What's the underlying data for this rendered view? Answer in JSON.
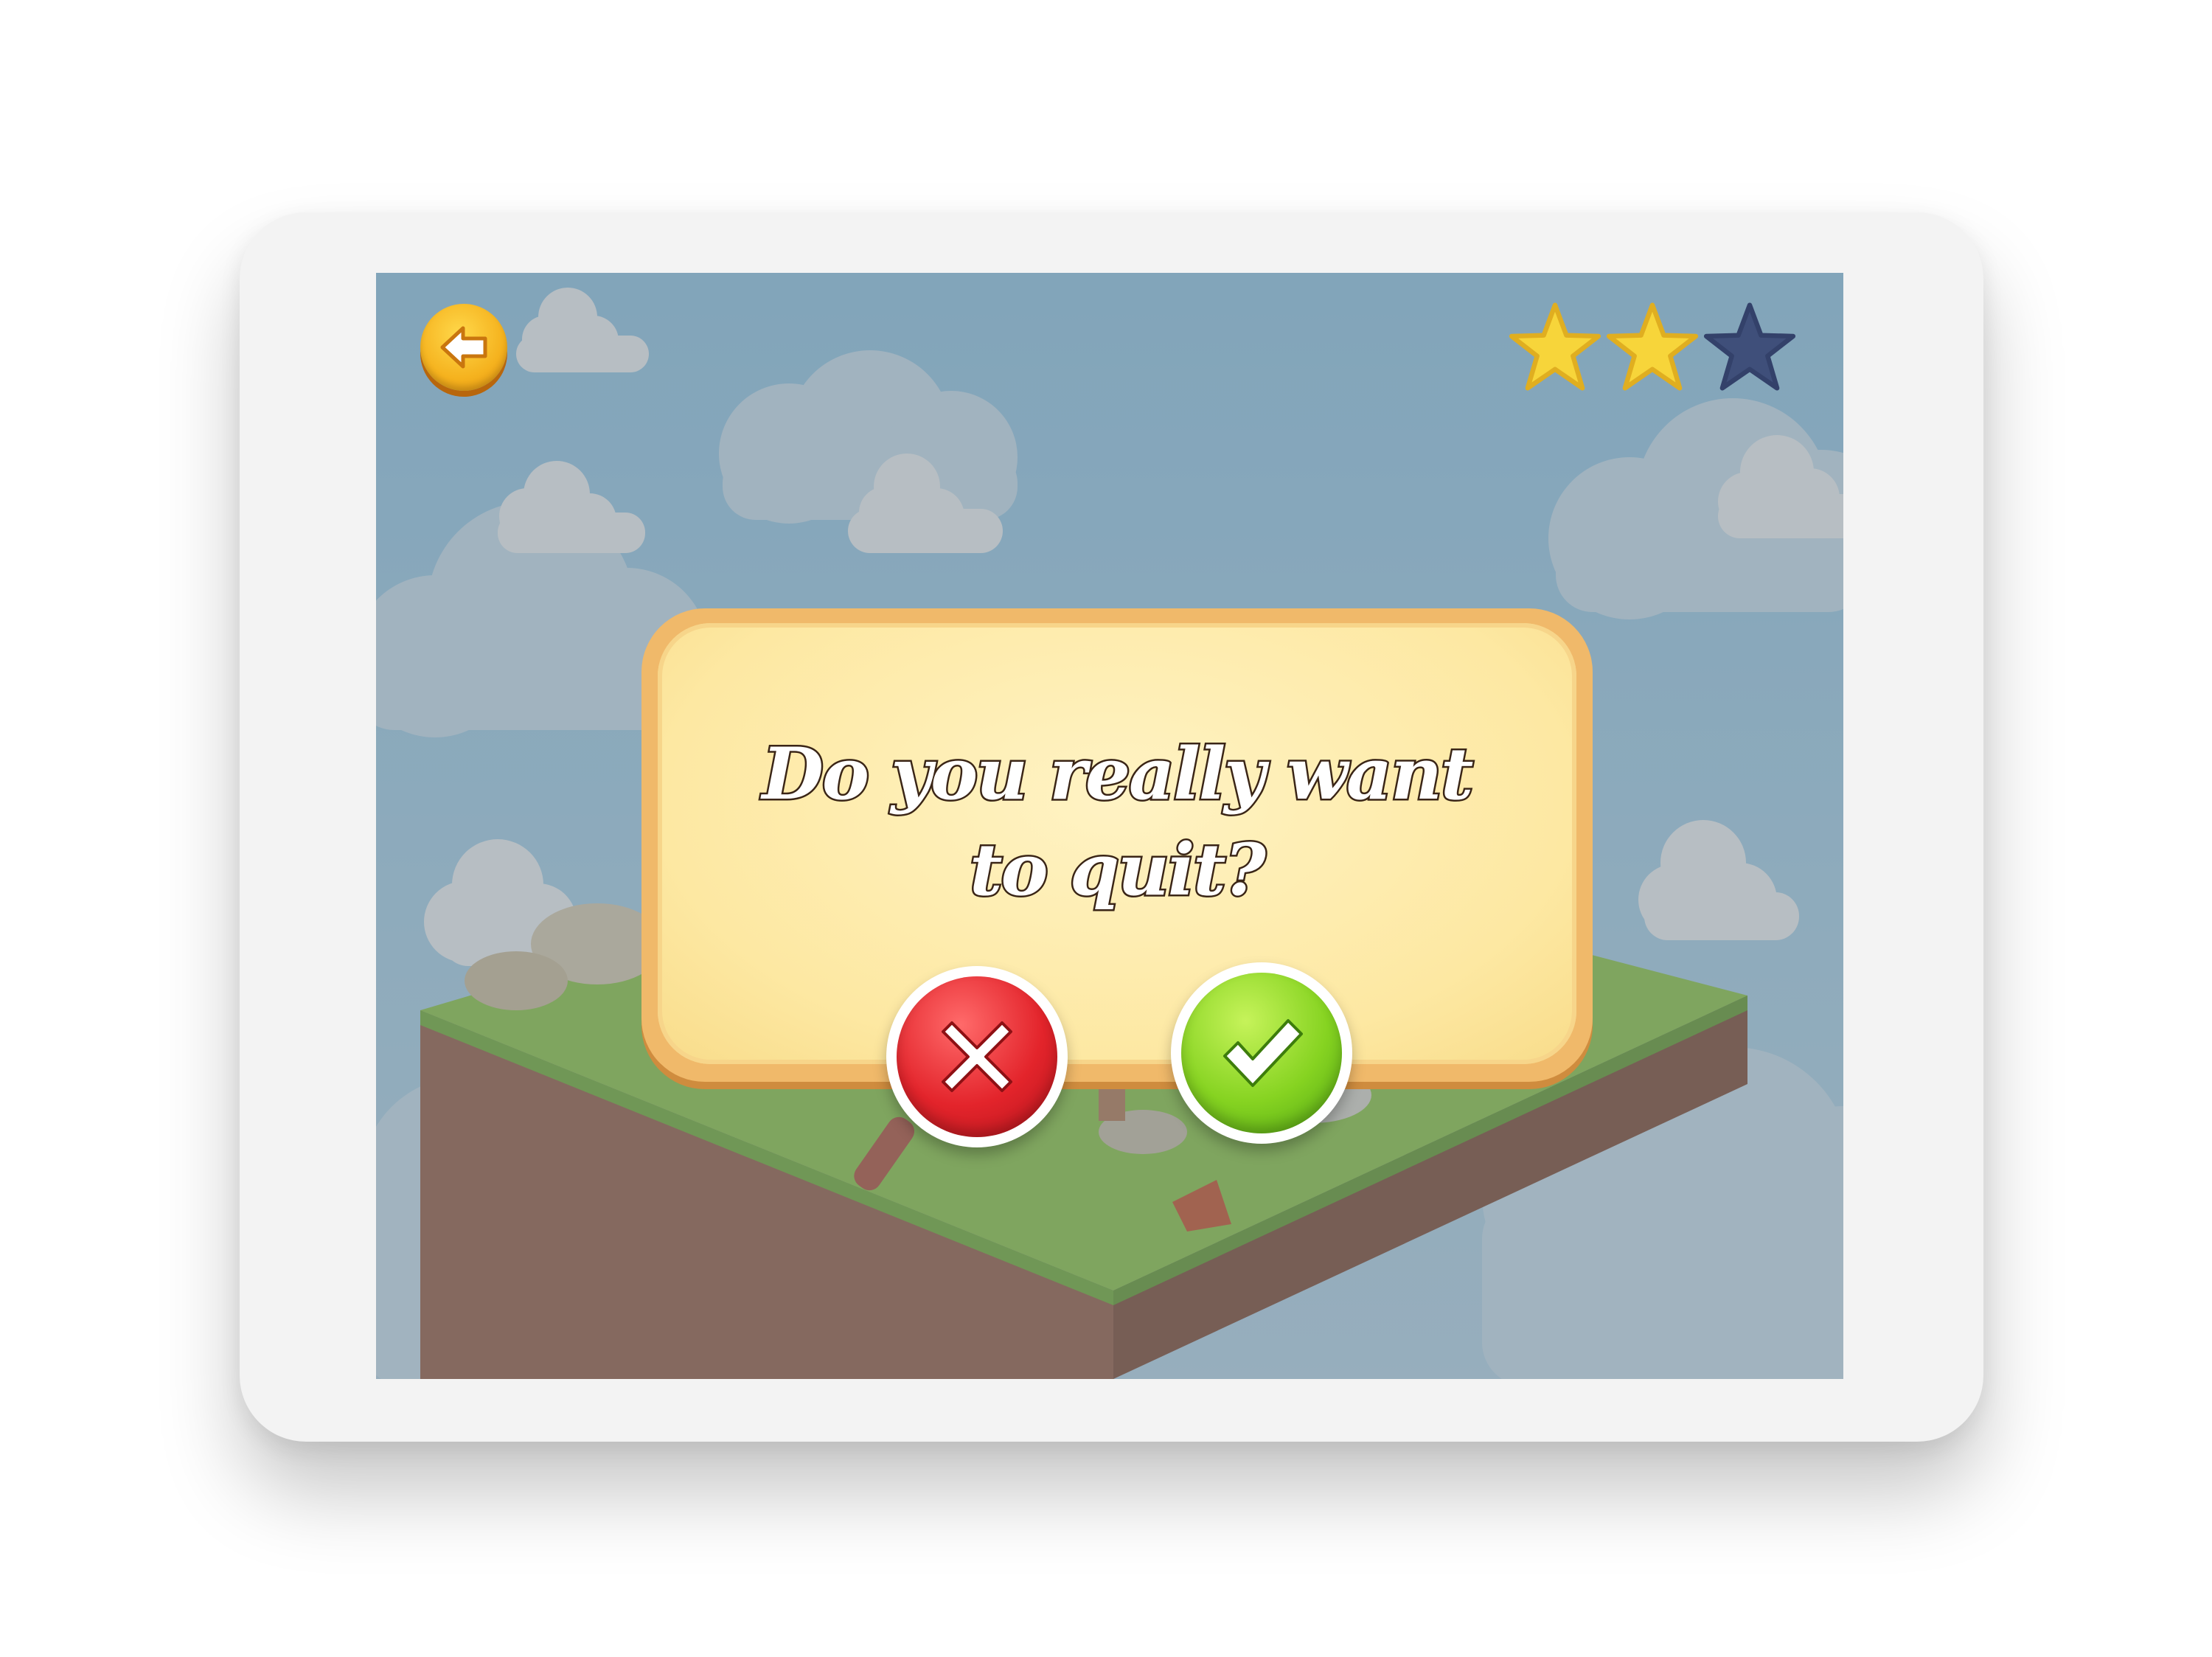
{
  "dialog": {
    "message_line1": "Do you really want",
    "message_line2": "to quit?"
  },
  "stars": {
    "earned": 2,
    "total": 3
  },
  "colors": {
    "star_earned": "#f7d53a",
    "star_empty": "#3f4f7a",
    "dialog_border": "#f0b96a",
    "dialog_fill": "#fde8a2",
    "cancel": "#e3242b",
    "confirm": "#86d321",
    "back": "#f5b21e"
  },
  "icons": {
    "back": "arrow-left-icon",
    "cancel": "x-icon",
    "confirm": "check-icon",
    "star": "star-icon"
  }
}
